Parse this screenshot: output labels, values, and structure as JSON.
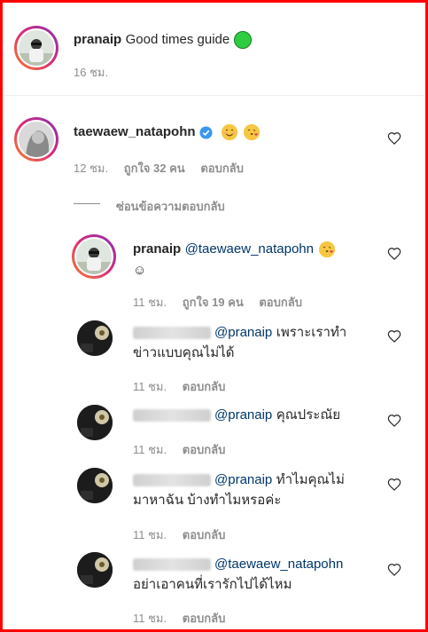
{
  "caption": {
    "username": "pranaip",
    "text": "Good times guide",
    "time": "16 ชม."
  },
  "comments": [
    {
      "username": "taewaew_natapohn",
      "verified": true,
      "time": "12 ชม.",
      "likes": "ถูกใจ 32 คน",
      "reply": "ตอบกลับ",
      "hide_replies": "ซ่อนข้อความตอบกลับ"
    }
  ],
  "replies": [
    {
      "username": "pranaip",
      "mention": "@taewaew_natapohn",
      "text_line2": "☺",
      "time": "11 ชม.",
      "likes": "ถูกใจ 19 คน",
      "reply": "ตอบกลับ"
    },
    {
      "mention": "@pranaip",
      "text_line1": "เพราะเราทำ",
      "text_line2": "ข่าวแบบคุณไม่ได้",
      "time": "11 ชม.",
      "reply": "ตอบกลับ"
    },
    {
      "mention": "@pranaip",
      "text_line1": "คุณประณัย",
      "time": "11 ชม.",
      "reply": "ตอบกลับ"
    },
    {
      "mention": "@pranaip",
      "text_line1": "ทำไมคุณไม่",
      "text_line2": "มาหาฉัน บ้างทำไมหรอค่ะ",
      "time": "11 ชม.",
      "reply": "ตอบกลับ"
    },
    {
      "mention": "@taewaew_natapohn",
      "text_line2": "อย่าเอาคนที่เรารักไปได้ไหม",
      "time": "11 ชม.",
      "reply": "ตอบกลับ"
    }
  ],
  "colors": {
    "border": "#ff0000",
    "mention": "#00376b",
    "meta": "#8e8e8e",
    "caption_dot": "#2ecc40"
  },
  "icons": [
    "heart-icon",
    "verified-badge-icon",
    "smile-emoji-icon",
    "kiss-emoji-icon"
  ]
}
